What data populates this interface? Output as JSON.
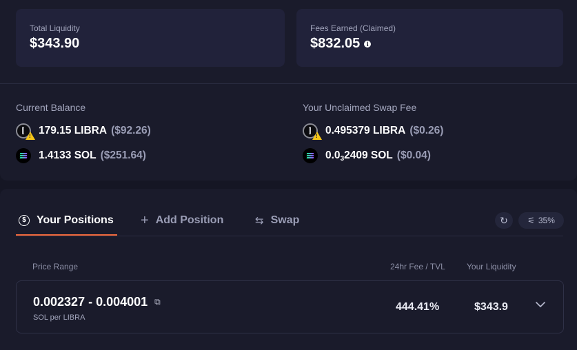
{
  "stats": {
    "total_liquidity_label": "Total Liquidity",
    "total_liquidity_value": "$343.90",
    "fees_earned_label": "Fees Earned (Claimed)",
    "fees_earned_value": "$832.05",
    "info_glyph": "i"
  },
  "balance": {
    "current_heading": "Current Balance",
    "unclaimed_heading": "Your Unclaimed Swap Fee",
    "current": [
      {
        "token": "LIBRA",
        "amount": "179.15 LIBRA",
        "usd": "($92.26)",
        "icon": "libra-token-icon"
      },
      {
        "token": "SOL",
        "amount": "1.4133 SOL",
        "usd": "($251.64)",
        "icon": "sol-token-icon"
      }
    ],
    "unclaimed": [
      {
        "token": "LIBRA",
        "amount": "0.495379 LIBRA",
        "usd": "($0.26)",
        "icon": "libra-token-icon"
      },
      {
        "token": "SOL",
        "amount_prefix": "0.0",
        "amount_sub": "3",
        "amount_suffix": "2409 SOL",
        "usd": "($0.04)",
        "icon": "sol-token-icon"
      }
    ]
  },
  "tabs": [
    {
      "label": "Your Positions",
      "active": true,
      "icon": "dollar-coin-icon",
      "glyph": "$"
    },
    {
      "label": "Add Position",
      "active": false,
      "icon": "plus-icon",
      "glyph": "+"
    },
    {
      "label": "Swap",
      "active": false,
      "icon": "swap-icon",
      "glyph": "⇆"
    }
  ],
  "controls": {
    "refresh_icon": "refresh-icon",
    "refresh_glyph": "↻",
    "slippage_icon": "sliders-icon",
    "slippage_glyph": "⚟",
    "slippage_value": "35%"
  },
  "table": {
    "headers": [
      "Price Range",
      "24hr Fee / TVL",
      "Your Liquidity"
    ],
    "rows": [
      {
        "range": "0.002327 - 0.004001",
        "unit": "SOL per LIBRA",
        "fee_tvl": "444.41%",
        "liquidity": "$343.9",
        "link_glyph": "⧉"
      }
    ]
  },
  "colors": {
    "background": "#151624",
    "panel": "#1a1b2b",
    "card": "#21223a",
    "accent": "#f26a3d",
    "warning": "#f5c518"
  }
}
